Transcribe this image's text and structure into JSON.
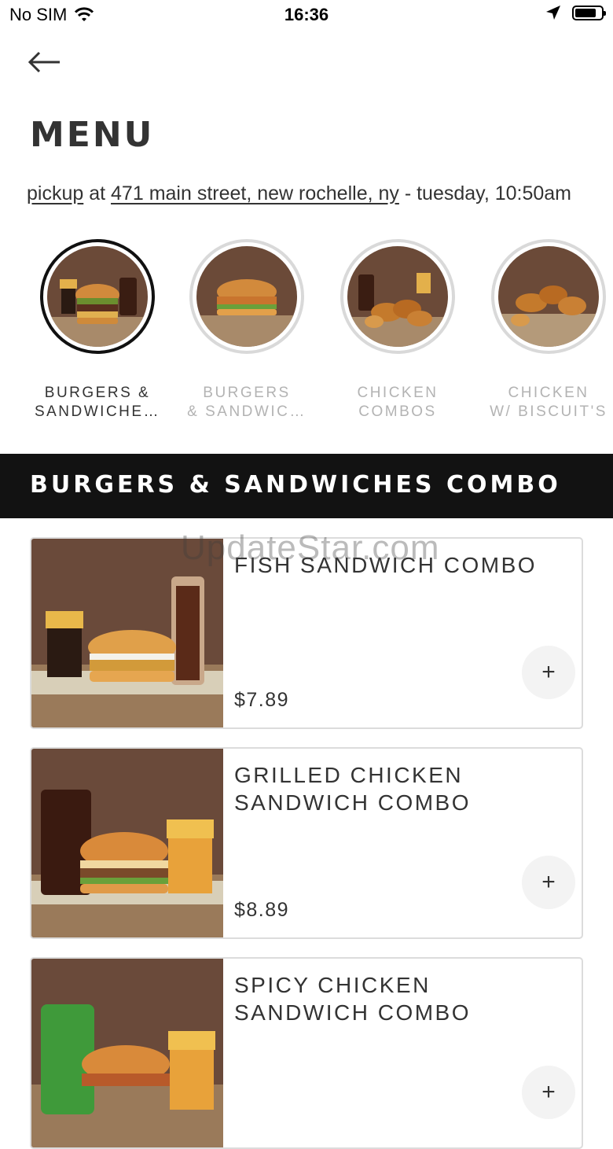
{
  "status_bar": {
    "carrier": "No SIM",
    "time": "16:36"
  },
  "header": {
    "title": "MENU"
  },
  "pickup": {
    "mode": "pickup",
    "at": "at",
    "address": "471 main street, new rochelle, ny",
    "when": "- tuesday, 10:50am"
  },
  "categories": [
    {
      "label": "BURGERS &\nSANDWICHE…",
      "active": true
    },
    {
      "label": "BURGERS\n& SANDWIC…",
      "active": false
    },
    {
      "label": "CHICKEN\nCOMBOS",
      "active": false
    },
    {
      "label": "CHICKEN\nW/ BISCUIT'S",
      "active": false
    }
  ],
  "section": {
    "title": "BURGERS & SANDWICHES COMBO"
  },
  "items": [
    {
      "name": "FISH SANDWICH COMBO",
      "price": "$7.89",
      "add": "+"
    },
    {
      "name": "GRILLED CHICKEN SANDWICH COMBO",
      "price": "$8.89",
      "add": "+"
    },
    {
      "name": "SPICY CHICKEN SANDWICH COMBO",
      "price": "",
      "add": "+"
    }
  ],
  "watermark": "UpdateStar.com",
  "colors": {
    "banner": "#121212",
    "active_ring": "#111111",
    "inactive_ring": "#d9d9d9"
  }
}
